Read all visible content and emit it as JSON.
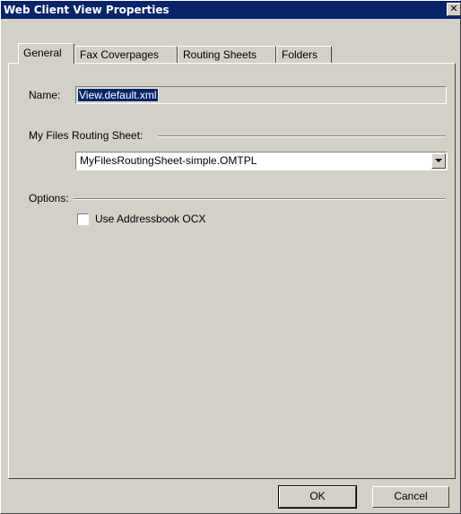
{
  "window": {
    "title": "Web Client View Properties",
    "close_glyph": "✕"
  },
  "tabs": [
    {
      "label": "General",
      "active": true
    },
    {
      "label": "Fax Coverpages",
      "active": false
    },
    {
      "label": "Routing Sheets",
      "active": false
    },
    {
      "label": "Folders",
      "active": false
    }
  ],
  "general": {
    "name_label": "Name:",
    "name_value": "View.default.xml",
    "routing_sheet_label": "My Files Routing Sheet:",
    "routing_sheet_value": "MyFilesRoutingSheet-simple.OMTPL",
    "options_label": "Options:",
    "use_addressbook_label": "Use Addressbook OCX",
    "use_addressbook_checked": false
  },
  "buttons": {
    "ok_label": "OK",
    "cancel_label": "Cancel"
  },
  "colors": {
    "titlebar": "#0a246a",
    "face": "#d4d0c8",
    "selection": "#0a246a"
  }
}
